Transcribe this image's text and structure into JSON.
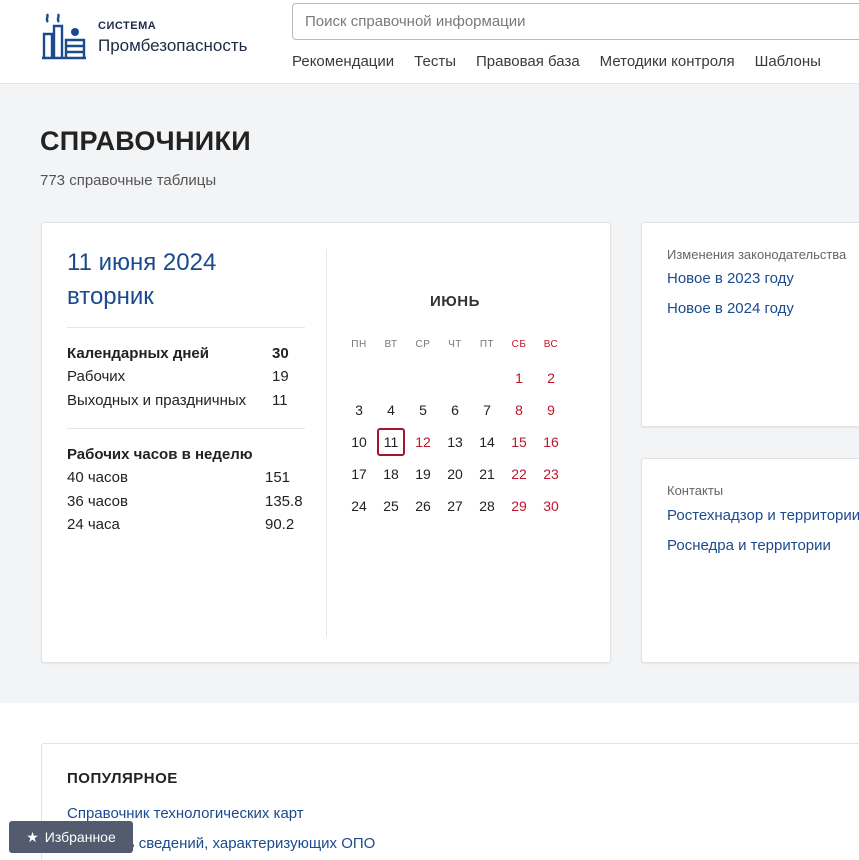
{
  "header": {
    "logo_small": "СИСТЕМА",
    "logo_big": "Промбезопасность",
    "search_placeholder": "Поиск справочной информации",
    "nav": [
      "Рекомендации",
      "Тесты",
      "Правовая база",
      "Методики контроля",
      "Шаблоны"
    ]
  },
  "page": {
    "title": "СПРАВОЧНИКИ",
    "subtitle": "773 справочные таблицы"
  },
  "calendar_card": {
    "date_line1": "11 июня 2024",
    "date_line2": "вторник",
    "calendar_days_label": "Календарных дней",
    "calendar_days_value": "30",
    "working_label": "Рабочих",
    "working_value": "19",
    "holidays_label": "Выходных и праздничных",
    "holidays_value": "11",
    "hours_title": "Рабочих часов в неделю",
    "hours": [
      {
        "label": "40 часов",
        "value": "151"
      },
      {
        "label": "36 часов",
        "value": "135.8"
      },
      {
        "label": "24 часа",
        "value": "90.2"
      }
    ],
    "month": "ИЮНЬ",
    "weekdays": [
      "ПН",
      "ВТ",
      "СР",
      "ЧТ",
      "ПТ",
      "СБ",
      "ВС"
    ],
    "weeks": [
      [
        "",
        "",
        "",
        "",
        "",
        "1",
        "2"
      ],
      [
        "3",
        "4",
        "5",
        "6",
        "7",
        "8",
        "9"
      ],
      [
        "10",
        "11",
        "12",
        "13",
        "14",
        "15",
        "16"
      ],
      [
        "17",
        "18",
        "19",
        "20",
        "21",
        "22",
        "23"
      ],
      [
        "24",
        "25",
        "26",
        "27",
        "28",
        "29",
        "30"
      ]
    ],
    "holiday_days": [
      "12"
    ],
    "today": "11",
    "accent_color": "#c0142b"
  },
  "law_card": {
    "label": "Изменения законодательства",
    "links": [
      "Новое в 2023 году",
      "Новое в 2024 году"
    ]
  },
  "contacts_card": {
    "label": "Контакты",
    "links": [
      "Ростехнадзор и территории",
      "Роснедра и территории"
    ]
  },
  "popular": {
    "title": "ПОПУЛЯРНОЕ",
    "links": [
      "Справочник технологических карт",
      "Перечень сведений, характеризующих ОПО"
    ]
  },
  "favorites_label": "Избранное"
}
